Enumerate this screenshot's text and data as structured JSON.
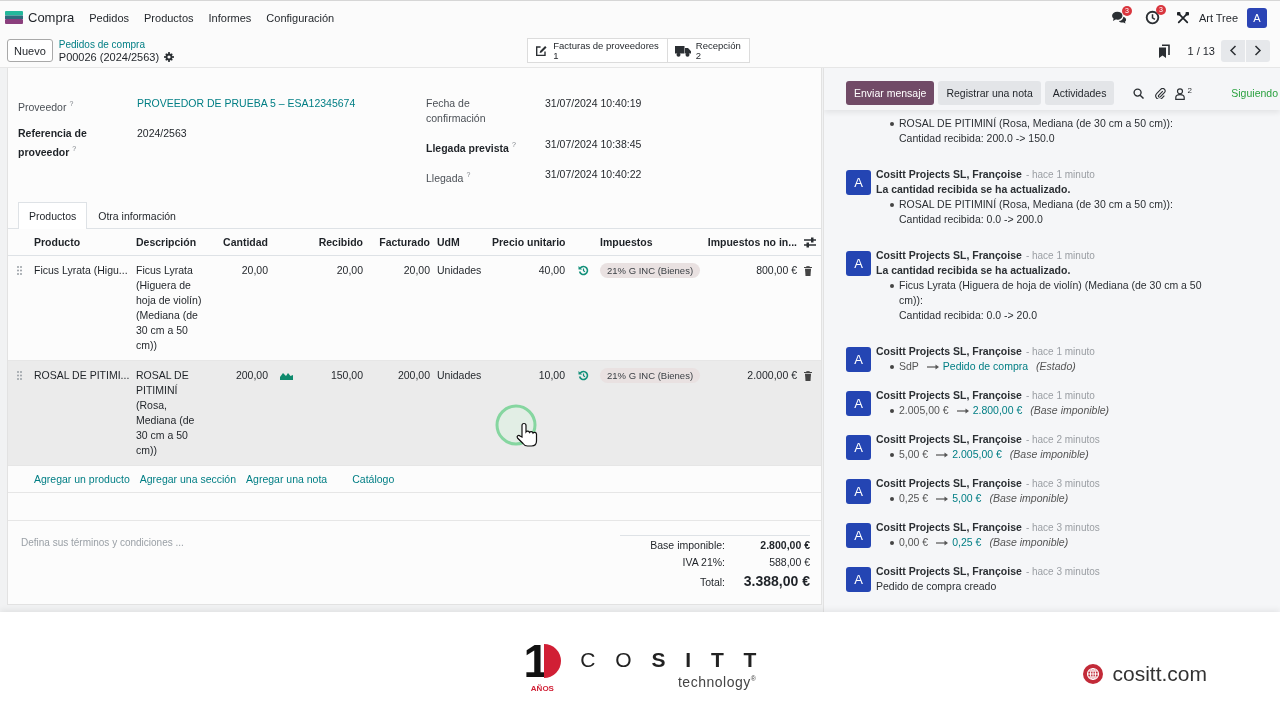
{
  "navbar": {
    "app_name": "Compra",
    "menus": [
      "Pedidos",
      "Productos",
      "Informes",
      "Configuración"
    ],
    "message_count": "3",
    "activity_count": "3",
    "company": "Art Tree",
    "avatar": "A"
  },
  "control_panel": {
    "new_button": "Nuevo",
    "breadcrumb": "Pedidos de compra",
    "record": "P00026 (2024/2563)",
    "smart_buttons": [
      {
        "kind": "invoices",
        "label": "Facturas de proveedores",
        "count": "1"
      },
      {
        "kind": "receipts",
        "label": "Recepción",
        "count": "2"
      }
    ],
    "pager": "1 / 13"
  },
  "form": {
    "fields_left": [
      {
        "label": "Proveedor$^{?}$",
        "bold": false,
        "kind": "link",
        "value": "PROVEEDOR DE PRUEBA 5 – ESA12345674"
      },
      {
        "label": "Referencia de proveedor$^{?}$",
        "bold": true,
        "kind": "text",
        "value": "2024/2563"
      }
    ],
    "fields_right": [
      {
        "label": "Fecha de confirmación",
        "bold": false,
        "value": "31/07/2024 10:40:19"
      },
      {
        "label": "Llegada prevista$^{?}$",
        "bold": true,
        "value": "31/07/2024 10:38:45"
      },
      {
        "label": "Llegada$^{?}$",
        "bold": false,
        "value": "31/07/2024 10:40:22"
      }
    ],
    "tabs": [
      {
        "label": "Productos",
        "selected": true
      },
      {
        "label": "Otra información",
        "selected": false
      }
    ],
    "lines": {
      "columns": {
        "product": "Producto",
        "description": "Descripción",
        "quantity": "Cantidad",
        "received": "Recibido",
        "billed": "Facturado",
        "uom": "UdM",
        "unit_price": "Precio unitario",
        "taxes": "Impuestos",
        "subtotal": "Impuestos no in..."
      },
      "rows": [
        {
          "product": "Ficus Lyrata (Higu...",
          "description": "Ficus Lyrata (Higuera de hoja de violín) (Mediana (de 30 cm a 50 cm))",
          "quantity": "20,00",
          "forecast_icon": false,
          "received": "20,00",
          "billed": "20,00",
          "uom": "Unidades",
          "unit_price": "40,00",
          "taxes": [
            "21% G INC (Bienes)"
          ],
          "subtotal": "800,00 €",
          "highlighted": false
        },
        {
          "product": "ROSAL DE PITIMI...",
          "description": "ROSAL DE PITIMINÍ (Rosa, Mediana (de 30 cm a 50 cm))",
          "quantity": "200,00",
          "forecast_icon": true,
          "received": "150,00",
          "billed": "200,00",
          "uom": "Unidades",
          "unit_price": "10,00",
          "taxes": [
            "21% G INC (Bienes)"
          ],
          "subtotal": "2.000,00 €",
          "highlighted": true
        }
      ]
    },
    "add_links": [
      "Agregar un producto",
      "Agregar una sección",
      "Agregar una nota",
      "Catálogo"
    ],
    "terms": {
      "placeholder": "Defina sus términos y condiciones ..."
    },
    "totals": [
      {
        "kind": "subtotal",
        "label": "Base imponible:",
        "value": "2.800,00 €"
      },
      {
        "kind": "tax",
        "label": "IVA 21%:",
        "value": "588,00 €"
      },
      {
        "kind": "total",
        "label": "Total:",
        "value": "3.388,00 €"
      }
    ]
  },
  "chatter": {
    "buttons": [
      {
        "label": "Enviar mensaje",
        "selected": true
      },
      {
        "label": "Registrar una nota",
        "selected": false
      },
      {
        "label": "Actividades",
        "selected": false
      }
    ],
    "followers": "2",
    "follow_state": "Siguiendo",
    "messages": [
      {
        "kind": "continued",
        "bullets": [
          {
            "text": "ROSAL DE PITIMINÍ (Rosa, Mediana (de 30 cm a 50 cm)):",
            "detail": "Cantidad recibida: 200.0 -> 150.0"
          }
        ]
      },
      {
        "kind": "update",
        "avatar": "A",
        "author": "Cositt Projects SL, Françoise",
        "time": "- hace 1 minuto",
        "title": "La cantidad recibida se ha actualizado.",
        "bullets": [
          {
            "text": "ROSAL DE PITIMINÍ (Rosa, Mediana (de 30 cm a 50 cm)):",
            "detail": "Cantidad recibida: 0.0 -> 200.0"
          }
        ]
      },
      {
        "kind": "update",
        "avatar": "A",
        "author": "Cositt Projects SL, Françoise",
        "time": "- hace 1 minuto",
        "title": "La cantidad recibida se ha actualizado.",
        "bullets": [
          {
            "text": "Ficus Lyrata (Higuera de hoja de violín) (Mediana (de 30 cm a 50 cm)):",
            "detail": "Cantidad recibida: 0.0 -> 20.0"
          }
        ]
      },
      {
        "kind": "tracking",
        "avatar": "A",
        "author": "Cositt Projects SL, Françoise",
        "time": "- hace 1 minuto",
        "changes": [
          {
            "old": "SdP",
            "new": "Pedido de compra",
            "field": "(Estado)"
          }
        ]
      },
      {
        "kind": "tracking",
        "avatar": "A",
        "author": "Cositt Projects SL, Françoise",
        "time": "- hace 1 minuto",
        "changes": [
          {
            "old": "2.005,00 €",
            "new": "2.800,00 €",
            "field": "(Base imponible)"
          }
        ]
      },
      {
        "kind": "tracking",
        "avatar": "A",
        "author": "Cositt Projects SL, Françoise",
        "time": "- hace 2 minutos",
        "changes": [
          {
            "old": "5,00 €",
            "new": "2.005,00 €",
            "field": "(Base imponible)"
          }
        ]
      },
      {
        "kind": "tracking",
        "avatar": "A",
        "author": "Cositt Projects SL, Françoise",
        "time": "- hace 3 minutos",
        "changes": [
          {
            "old": "0,25 €",
            "new": "5,00 €",
            "field": "(Base imponible)"
          }
        ]
      },
      {
        "kind": "tracking",
        "avatar": "A",
        "author": "Cositt Projects SL, Françoise",
        "time": "- hace 3 minutos",
        "changes": [
          {
            "old": "0,00 €",
            "new": "0,25 €",
            "field": "(Base imponible)"
          }
        ]
      },
      {
        "kind": "note",
        "avatar": "A",
        "author": "Cositt Projects SL, Françoise",
        "time": "- hace 3 minutos",
        "body": "Pedido de compra creado"
      }
    ]
  },
  "footer": {
    "anniversary_number": "1",
    "anniversary_caption": "AÑOS",
    "brand": "C O **S I T T**",
    "tagline": "technology$^{®}$",
    "website": "cositt.com"
  }
}
